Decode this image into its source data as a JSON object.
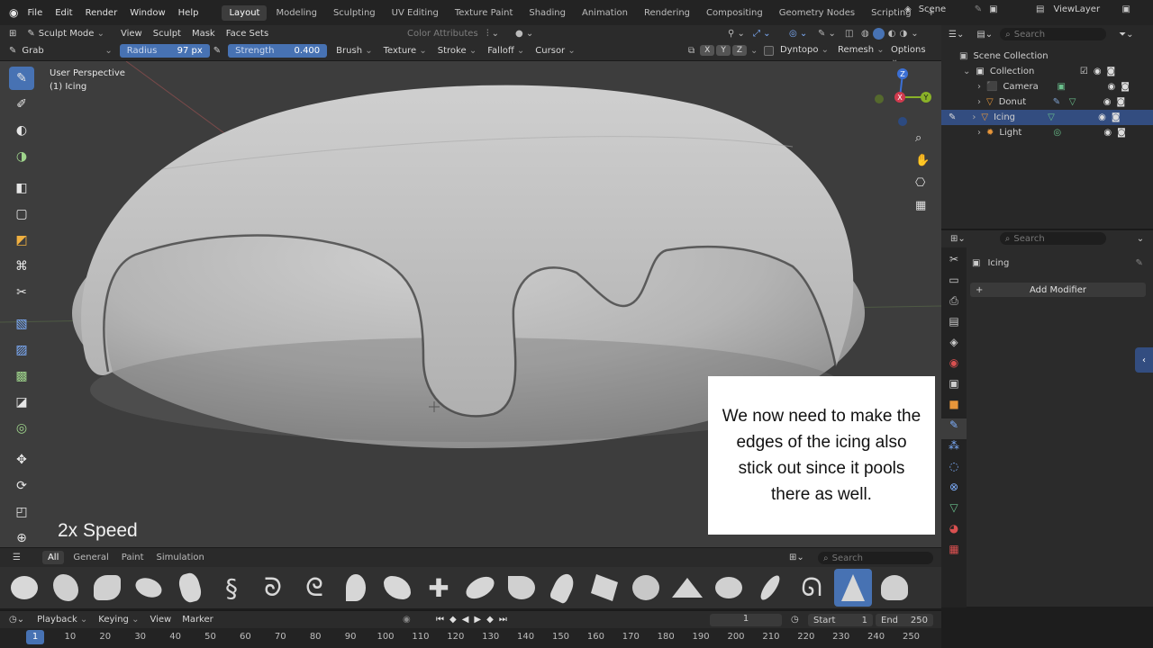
{
  "topbar": {
    "menus": [
      "File",
      "Edit",
      "Render",
      "Window",
      "Help"
    ],
    "workspaces": [
      "Layout",
      "Modeling",
      "Sculpting",
      "UV Editing",
      "Texture Paint",
      "Shading",
      "Animation",
      "Rendering",
      "Compositing",
      "Geometry Nodes",
      "Scripting"
    ],
    "active_workspace": "Layout",
    "add_tab": "+",
    "scene": "Scene",
    "view_layer": "ViewLayer"
  },
  "header": {
    "mode": "Sculpt Mode",
    "menus": [
      "View",
      "Sculpt",
      "Mask",
      "Face Sets"
    ],
    "color_attributes": "Color Attributes"
  },
  "toolrow": {
    "brush": "Grab",
    "radius_label": "Radius",
    "radius_value": "97 px",
    "strength_label": "Strength",
    "strength_value": "0.400",
    "menus": [
      "Brush",
      "Texture",
      "Stroke",
      "Falloff",
      "Cursor"
    ],
    "axes": [
      "X",
      "Y",
      "Z"
    ],
    "dyntopo": "Dyntopo",
    "remesh": "Remesh",
    "options": "Options"
  },
  "viewport": {
    "perspective": "User Perspective",
    "object": "(1) Icing",
    "gizmo": {
      "z": "Z",
      "y": "Y",
      "x": "X"
    }
  },
  "outliner": {
    "search_placeholder": "Search",
    "root": "Scene Collection",
    "collection": "Collection",
    "items": [
      "Camera",
      "Donut",
      "Icing",
      "Light"
    ],
    "selected": "Icing"
  },
  "properties": {
    "search_placeholder": "Search",
    "object": "Icing",
    "add_modifier": "Add Modifier"
  },
  "shelf": {
    "tabs": [
      "All",
      "General",
      "Paint",
      "Simulation"
    ],
    "search_placeholder": "Search"
  },
  "timeline": {
    "menus": [
      "Playback",
      "Keying",
      "View",
      "Marker"
    ],
    "current_frame": "1",
    "start_label": "Start",
    "start_value": "1",
    "end_label": "End",
    "end_value": "250",
    "ticks": [
      "1",
      "10",
      "20",
      "30",
      "40",
      "50",
      "60",
      "70",
      "80",
      "90",
      "100",
      "110",
      "120",
      "130",
      "140",
      "150",
      "160",
      "170",
      "180",
      "190",
      "200",
      "210",
      "220",
      "230",
      "240",
      "250"
    ]
  },
  "overlay": {
    "caption": "We now need to make the edges of the icing also stick out since it pools there as well.",
    "speed": "2x Speed"
  },
  "colors": {
    "accent": "#4772b3",
    "viewport": "#3d3d3d",
    "mesh": "#bdbdbd"
  }
}
